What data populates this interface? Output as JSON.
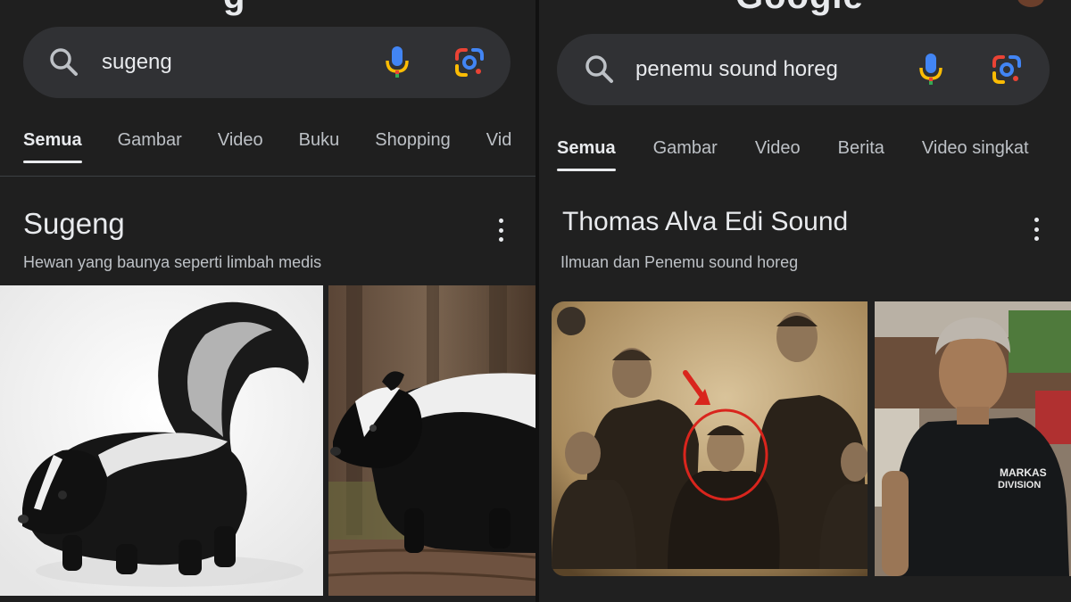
{
  "left": {
    "search": {
      "query": "sugeng"
    },
    "tabs": [
      "Semua",
      "Gambar",
      "Video",
      "Buku",
      "Shopping",
      "Vid"
    ],
    "result": {
      "title": "Sugeng",
      "subtitle": "Hewan yang baunya seperti limbah medis"
    },
    "images": [
      {
        "icon": "skunk-photo",
        "desc": "skunk on white background"
      },
      {
        "icon": "skunk-photo",
        "desc": "skunk on wooden log"
      }
    ]
  },
  "right": {
    "search": {
      "query": "penemu sound horeg"
    },
    "tabs": [
      "Semua",
      "Gambar",
      "Video",
      "Berita",
      "Video singkat"
    ],
    "result": {
      "title": "Thomas Alva Edi Sound",
      "subtitle": "Ilmuan dan Penemu sound horeg"
    },
    "images": [
      {
        "icon": "group-portrait-photo",
        "desc": "vintage sepia group photo with red arrow and circle"
      },
      {
        "icon": "person-photo",
        "desc": "man in black t-shirt"
      }
    ],
    "tshirt_text": [
      "MARKAS",
      "DIVISION"
    ]
  },
  "colors": {
    "background": "#1f1f1f",
    "search_bg": "#303134",
    "text_primary": "#e8eaed",
    "text_secondary": "#bdc1c6",
    "annotation_red": "#d9251d"
  },
  "icons": [
    "search-icon",
    "mic-icon",
    "google-lens-icon",
    "more-vert-icon"
  ]
}
